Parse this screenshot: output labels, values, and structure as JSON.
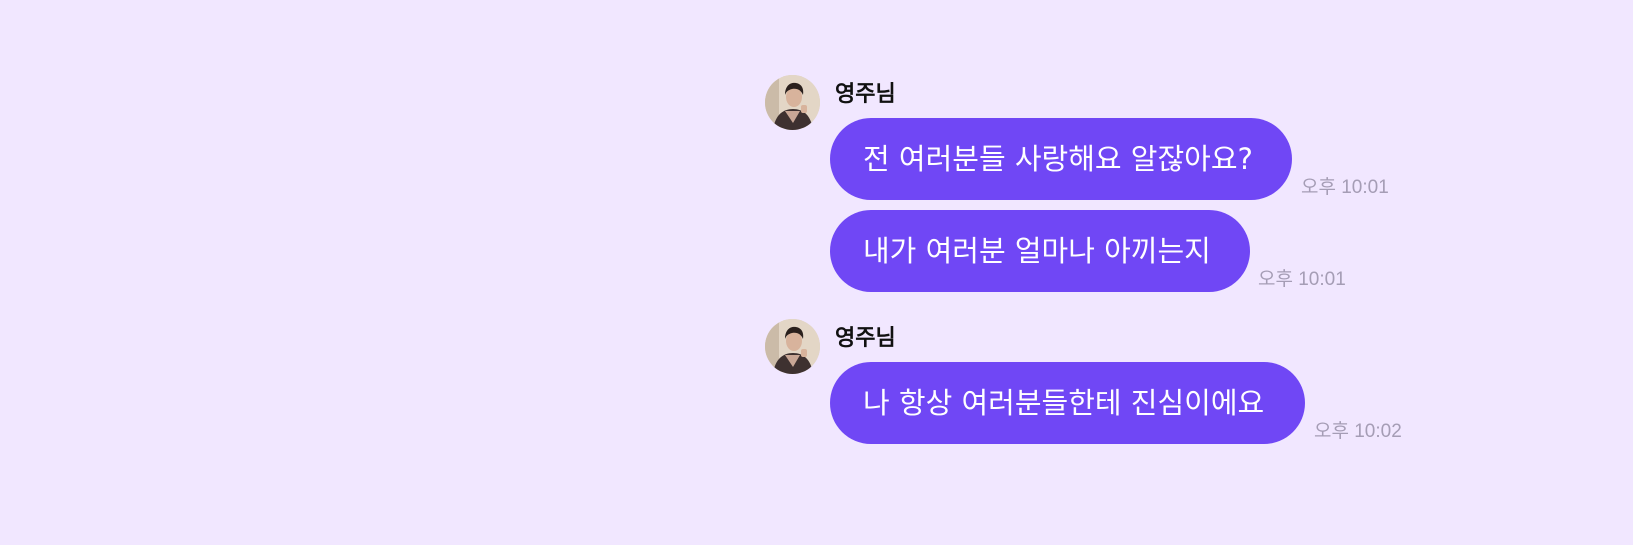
{
  "colors": {
    "background": "#f1e7ff",
    "bubble": "#7047f5",
    "bubble_text": "#ffffff",
    "sender_name": "#111111",
    "timestamp": "#a59db5"
  },
  "chat": {
    "groups": [
      {
        "sender": "영주님",
        "avatar_icon": "profile-photo-icon",
        "messages": [
          {
            "text": "전 여러분들 사랑해요 알잖아요?",
            "time": "오후 10:01"
          },
          {
            "text": "내가 여러분 얼마나 아끼는지",
            "time": "오후 10:01"
          }
        ]
      },
      {
        "sender": "영주님",
        "avatar_icon": "profile-photo-icon",
        "messages": [
          {
            "text": "나 항상 여러분들한테 진심이에요",
            "time": "오후 10:02"
          }
        ]
      }
    ]
  }
}
